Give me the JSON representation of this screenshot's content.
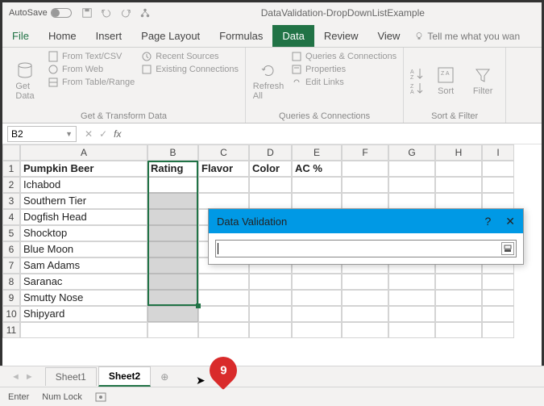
{
  "titlebar": {
    "autosave": "AutoSave",
    "docname": "DataValidation-DropDownListExample"
  },
  "menu": {
    "file": "File",
    "home": "Home",
    "insert": "Insert",
    "pagelayout": "Page Layout",
    "formulas": "Formulas",
    "data": "Data",
    "review": "Review",
    "view": "View",
    "tellme": "Tell me what you wan"
  },
  "ribbon": {
    "g1": {
      "getdata": "Get\nData",
      "fromtextcsv": "From Text/CSV",
      "fromweb": "From Web",
      "fromtablerange": "From Table/Range",
      "recent": "Recent Sources",
      "existing": "Existing Connections",
      "label": "Get & Transform Data"
    },
    "g2": {
      "refresh": "Refresh\nAll",
      "queries": "Queries & Connections",
      "properties": "Properties",
      "editlinks": "Edit Links",
      "label": "Queries & Connections"
    },
    "g3": {
      "sort": "Sort",
      "filter": "Filter",
      "label": "Sort & Filter"
    }
  },
  "namebox": "B2",
  "columns": [
    "A",
    "B",
    "C",
    "D",
    "E",
    "F",
    "G",
    "H",
    "I"
  ],
  "headers": {
    "a": "Pumpkin Beer",
    "b": "Rating",
    "c": "Flavor",
    "d": "Color",
    "e": "AC %"
  },
  "rows": [
    "Ichabod",
    "Southern Tier",
    "Dogfish Head",
    "Shocktop",
    "Blue Moon",
    "Sam Adams",
    "Saranac",
    "Smutty Nose",
    "Shipyard"
  ],
  "dialog": {
    "title": "Data Validation"
  },
  "sheets": {
    "s1": "Sheet1",
    "s2": "Sheet2"
  },
  "status": {
    "mode": "Enter",
    "numlock": "Num Lock"
  },
  "callout": "9"
}
